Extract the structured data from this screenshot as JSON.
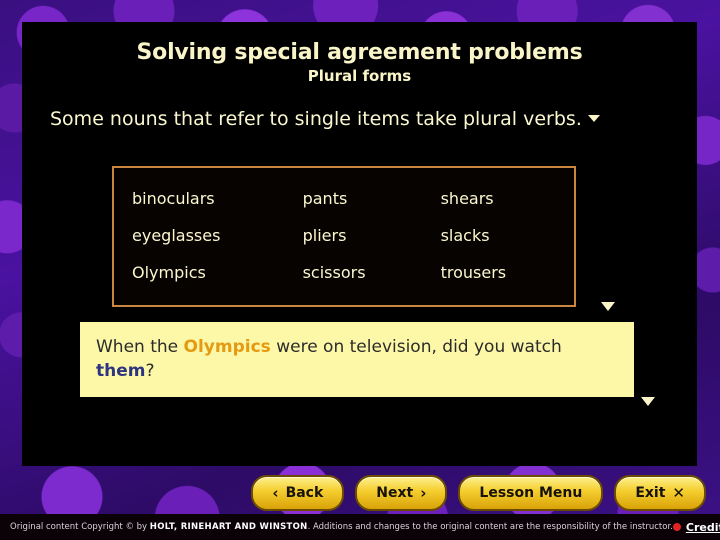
{
  "slide": {
    "title": "Solving special agreement problems",
    "subtitle": "Plural forms",
    "lead_text": "Some nouns that refer to single items take plural verbs.",
    "title_color": "#faf5c8",
    "panel_bg": "#000000"
  },
  "word_table": {
    "border_color": "#c9873f",
    "rows": [
      [
        "binoculars",
        "pants",
        "shears"
      ],
      [
        "eyeglasses",
        "pliers",
        "slacks"
      ],
      [
        "Olympics",
        "scissors",
        "trousers"
      ]
    ]
  },
  "example_box": {
    "bg_color": "#fcf8a8",
    "highlight_orange": "#e49a12",
    "highlight_navy": "#2e3580",
    "part1": "When the ",
    "highlight1": "Olympics",
    "part2": " were on television, did you watch ",
    "highlight2": "them",
    "part3": "?"
  },
  "markers": {
    "lead_marker": "triangle-down",
    "table_marker": "triangle-down",
    "example_marker": "triangle-down"
  },
  "nav": {
    "buttons": [
      {
        "label": "Back",
        "glyph": "‹",
        "glyph_side": "left",
        "name": "back"
      },
      {
        "label": "Next",
        "glyph": "›",
        "glyph_side": "right",
        "name": "next"
      },
      {
        "label": "Lesson Menu",
        "glyph": "",
        "glyph_side": "none",
        "name": "lesson-menu"
      },
      {
        "label": "Exit",
        "glyph": "✕",
        "glyph_side": "right",
        "name": "exit"
      }
    ]
  },
  "footer": {
    "prefix": "Original content Copyright © by ",
    "publisher": "HOLT, RINEHART AND WINSTON",
    "suffix": ". Additions and changes to the original content are the responsibility of the instructor.",
    "credits_label": "Credits",
    "credits_dot_color": "#e02424"
  }
}
